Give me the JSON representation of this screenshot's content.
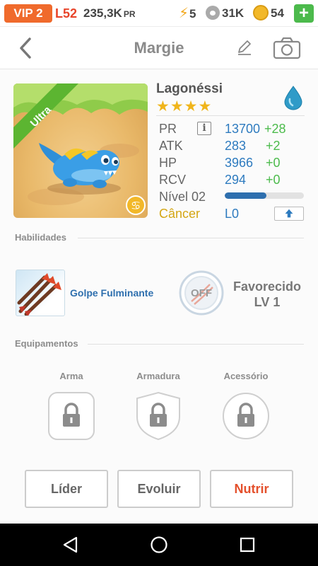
{
  "topbar": {
    "vip": "VIP 2",
    "level": "L52",
    "power": "235,3K",
    "power_unit": "PR",
    "energy": "5",
    "paws": "31K",
    "coins": "54",
    "plus_label": "+"
  },
  "header": {
    "title": "Margie"
  },
  "pet": {
    "badge": "Ultra",
    "name": "Lagonéssi",
    "stars": "★★★★",
    "element_icon": "water-drop-icon",
    "stats": {
      "pr": {
        "label": "PR",
        "value": "13700",
        "inc": "+28"
      },
      "atk": {
        "label": "ATK",
        "value": "283",
        "inc": "+2"
      },
      "hp": {
        "label": "HP",
        "value": "3966",
        "inc": "+0"
      },
      "rcv": {
        "label": "RCV",
        "value": "294",
        "inc": "+0"
      }
    },
    "level_label": "Nível 02",
    "xp_fraction": 0.53,
    "sign_label": "Câncer",
    "sign_level": "L0"
  },
  "abilities": {
    "title": "Habilidades",
    "skill_name": "Golpe Fulminante",
    "off_label": "OFF",
    "favored_line1": "Favorecido",
    "favored_line2": "LV 1"
  },
  "equipment": {
    "title": "Equipamentos",
    "slots": [
      "Arma",
      "Armadura",
      "Acessório"
    ]
  },
  "actions": {
    "leader": "Líder",
    "evolve": "Evoluir",
    "feed": "Nutrir"
  },
  "colors": {
    "accent_orange": "#f06a2c",
    "stat_blue": "#2e7bbf",
    "stat_green": "#4cbb4c",
    "ultra_green": "#5cb531",
    "feed_red": "#e4502c"
  }
}
